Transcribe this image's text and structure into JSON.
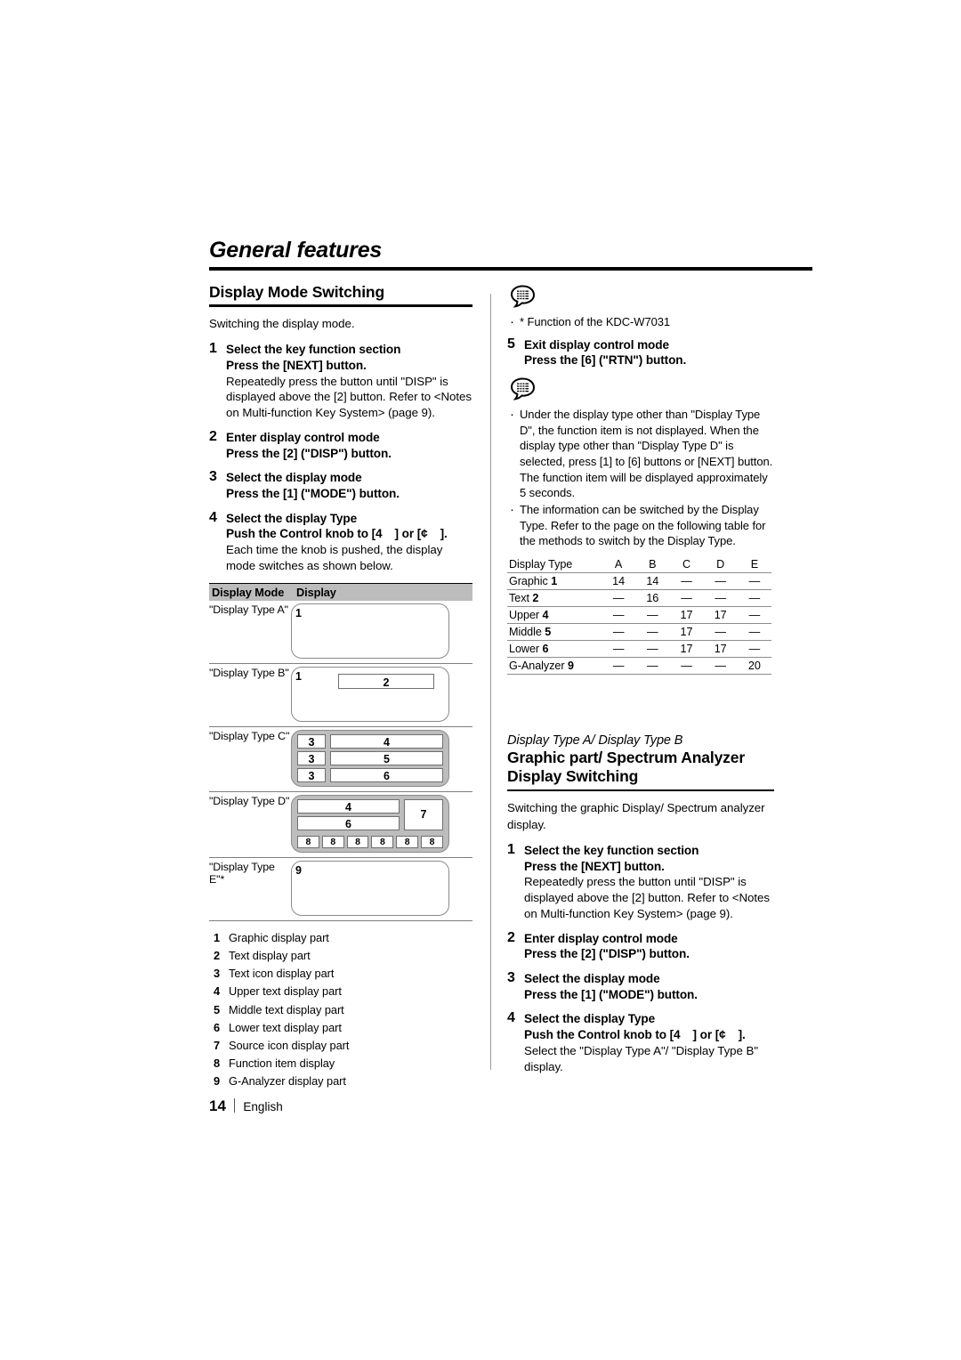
{
  "chapter": {
    "title": "General features"
  },
  "footer": {
    "page_number": "14",
    "language": "English"
  },
  "left": {
    "section_title": "Display Mode Switching",
    "intro": "Switching the display mode.",
    "steps": [
      {
        "num": "1",
        "title": "Select the key function section",
        "action": "Press the [NEXT] button.",
        "detail": "Repeatedly press the button until \"DISP\" is displayed above the [2] button. Refer to <Notes on Multi-function Key System> (page 9)."
      },
      {
        "num": "2",
        "title": "Enter display control mode",
        "action": "Press the [2] (\"DISP\") button.",
        "detail": ""
      },
      {
        "num": "3",
        "title": "Select the display mode",
        "action": "Press the [1] (\"MODE\") button.",
        "detail": ""
      },
      {
        "num": "4",
        "title": "Select the display Type",
        "action_pre": "Push the Control knob to [4",
        "action_mid": "] or [¢",
        "action_post": "].",
        "detail": "Each time the knob is pushed, the display mode switches as shown below."
      }
    ],
    "display_mode_figure": {
      "header": {
        "col1": "Display Mode",
        "col2": "Display"
      },
      "rows": [
        {
          "label": "\"Display Type A\"",
          "parts": [
            "1"
          ]
        },
        {
          "label": "\"Display Type B\"",
          "parts": [
            "1",
            "2"
          ]
        },
        {
          "label": "\"Display Type C\"",
          "parts": [
            "3",
            "4",
            "3",
            "5",
            "3",
            "6"
          ]
        },
        {
          "label": "\"Display Type D\"",
          "parts": [
            "4",
            "7",
            "6",
            "8",
            "8",
            "8",
            "8",
            "8",
            "8"
          ]
        },
        {
          "label": "\"Display Type E\"*",
          "parts": [
            "9"
          ]
        }
      ]
    },
    "legend": [
      {
        "num": "1",
        "text": "Graphic display part"
      },
      {
        "num": "2",
        "text": "Text display part"
      },
      {
        "num": "3",
        "text": "Text icon display part"
      },
      {
        "num": "4",
        "text": "Upper text display part"
      },
      {
        "num": "5",
        "text": "Middle text display part"
      },
      {
        "num": "6",
        "text": "Lower text display part"
      },
      {
        "num": "7",
        "text": "Source icon display part"
      },
      {
        "num": "8",
        "text": "Function item display"
      },
      {
        "num": "9",
        "text": "G-Analyzer display part"
      }
    ]
  },
  "right": {
    "note_top": {
      "icon": "memo-bubble-icon",
      "items": [
        "* Function of the KDC-W7031"
      ]
    },
    "step5": {
      "num": "5",
      "title": "Exit display control mode",
      "action": "Press the [6] (\"RTN\") button."
    },
    "note_mid": {
      "icon": "memo-bubble-icon",
      "items": [
        "Under the display type other than \"Display Type D\", the function item is not displayed. When the display type other than \"Display Type D\" is selected, press [1] to [6] buttons or [NEXT] button. The function item will be displayed approximately 5 seconds.",
        "The information can be switched by the Display Type. Refer to the page on the following table for the methods to switch by the Display Type."
      ]
    },
    "display_type_table": {
      "columns": [
        "Display Type",
        "A",
        "B",
        "C",
        "D",
        "E"
      ],
      "rows": [
        {
          "name": "Graphic",
          "part": "1",
          "values": [
            "14",
            "14",
            "—",
            "—",
            "—"
          ]
        },
        {
          "name": "Text",
          "part": "2",
          "values": [
            "—",
            "16",
            "—",
            "—",
            "—"
          ]
        },
        {
          "name": "Upper",
          "part": "4",
          "values": [
            "—",
            "—",
            "17",
            "17",
            "—"
          ]
        },
        {
          "name": "Middle",
          "part": "5",
          "values": [
            "—",
            "—",
            "17",
            "—",
            "—"
          ]
        },
        {
          "name": "Lower",
          "part": "6",
          "values": [
            "—",
            "—",
            "17",
            "17",
            "—"
          ]
        },
        {
          "name": "G-Analyzer",
          "part": "9",
          "values": [
            "—",
            "—",
            "—",
            "—",
            "20"
          ]
        }
      ]
    },
    "section2": {
      "eyebrow": "Display Type A/ Display Type B",
      "title_line1": "Graphic part/ Spectrum Analyzer",
      "title_line2": "Display Switching",
      "intro": "Switching the graphic Display/ Spectrum analyzer display.",
      "steps": [
        {
          "num": "1",
          "title": "Select the key function section",
          "action": "Press the [NEXT] button.",
          "detail": "Repeatedly press the button until \"DISP\" is displayed above the [2] button. Refer to <Notes on Multi-function Key System> (page 9)."
        },
        {
          "num": "2",
          "title": "Enter display control mode",
          "action": "Press the [2] (\"DISP\") button.",
          "detail": ""
        },
        {
          "num": "3",
          "title": "Select the display mode",
          "action": "Press the [1] (\"MODE\") button.",
          "detail": ""
        },
        {
          "num": "4",
          "title": "Select the display Type",
          "action_pre": "Push the Control knob to [4",
          "action_mid": "] or [¢",
          "action_post": "].",
          "detail": "Select the \"Display Type A\"/ \"Display Type B\" display."
        }
      ]
    }
  }
}
